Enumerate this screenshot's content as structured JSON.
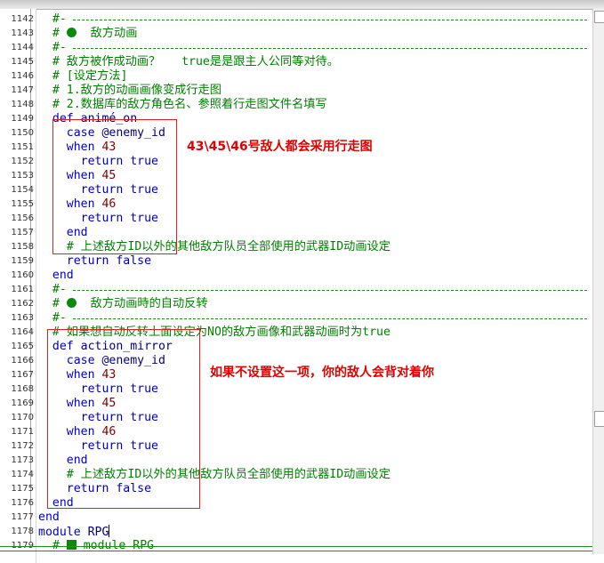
{
  "lines": [
    {
      "n": "1142",
      "t": "  #-"
    },
    {
      "n": "1143",
      "t": "  # ",
      "b": "敌方动画"
    },
    {
      "n": "1144",
      "t": "  #-"
    },
    {
      "n": "1145",
      "t": "  # 敌方被作成动画？   true是是跟主人公同等对待。"
    },
    {
      "n": "1146",
      "t": "  # [设定方法]"
    },
    {
      "n": "1147",
      "t": "  # 1.敌方的动画画像变成行走图"
    },
    {
      "n": "1148",
      "t": "  # 2.数据库的敌方角色名、参照着行走图文件名填写"
    },
    {
      "n": "1149",
      "t": "  def animé_on"
    },
    {
      "n": "1150",
      "t": "    case @enemy_id"
    },
    {
      "n": "1151",
      "t": "    when 43"
    },
    {
      "n": "1152",
      "t": "      return true"
    },
    {
      "n": "1153",
      "t": "    when 45"
    },
    {
      "n": "1154",
      "t": "      return true"
    },
    {
      "n": "1155",
      "t": "    when 46"
    },
    {
      "n": "1156",
      "t": "      return true"
    },
    {
      "n": "1157",
      "t": "    end"
    },
    {
      "n": "1158",
      "t": "    # 上述敌方ID以外的其他敌方队员全部使用的武器ID动画设定"
    },
    {
      "n": "1159",
      "t": "    return false"
    },
    {
      "n": "1160",
      "t": "  end"
    },
    {
      "n": "1161",
      "t": "  #-"
    },
    {
      "n": "1162",
      "t": "  # ",
      "b": "敌方动画時的自动反转"
    },
    {
      "n": "1163",
      "t": "  #-"
    },
    {
      "n": "1164",
      "t": "  # 如果想自动反转上面设定为NO的敌方画像和武器动画时为true"
    },
    {
      "n": "1165",
      "t": "  def action_mirror"
    },
    {
      "n": "1166",
      "t": "    case @enemy_id"
    },
    {
      "n": "1167",
      "t": "    when 43"
    },
    {
      "n": "1168",
      "t": "      return true"
    },
    {
      "n": "1169",
      "t": "    when 45"
    },
    {
      "n": "1170",
      "t": "      return true"
    },
    {
      "n": "1171",
      "t": "    when 46"
    },
    {
      "n": "1172",
      "t": "      return true"
    },
    {
      "n": "1173",
      "t": "    end"
    },
    {
      "n": "1174",
      "t": "    # 上述敌方ID以外的其他敌方队员全部使用的武器ID动画设定"
    },
    {
      "n": "1175",
      "t": "    return false"
    },
    {
      "n": "1176",
      "t": "  end"
    },
    {
      "n": "1177",
      "t": "end"
    },
    {
      "n": "1178",
      "t": "module RPG"
    },
    {
      "n": "1179",
      "t": "  # ",
      "sq": "module RPG"
    }
  ],
  "annotations": {
    "note1": "43\\45\\46号敌人都会采用行走图",
    "note2": "如果不设置这一项，你的敌人会背对着你"
  },
  "colors": {
    "comment": "#008000",
    "keyword": "#0000c0",
    "number": "#800000",
    "annotation": "#e00000"
  }
}
